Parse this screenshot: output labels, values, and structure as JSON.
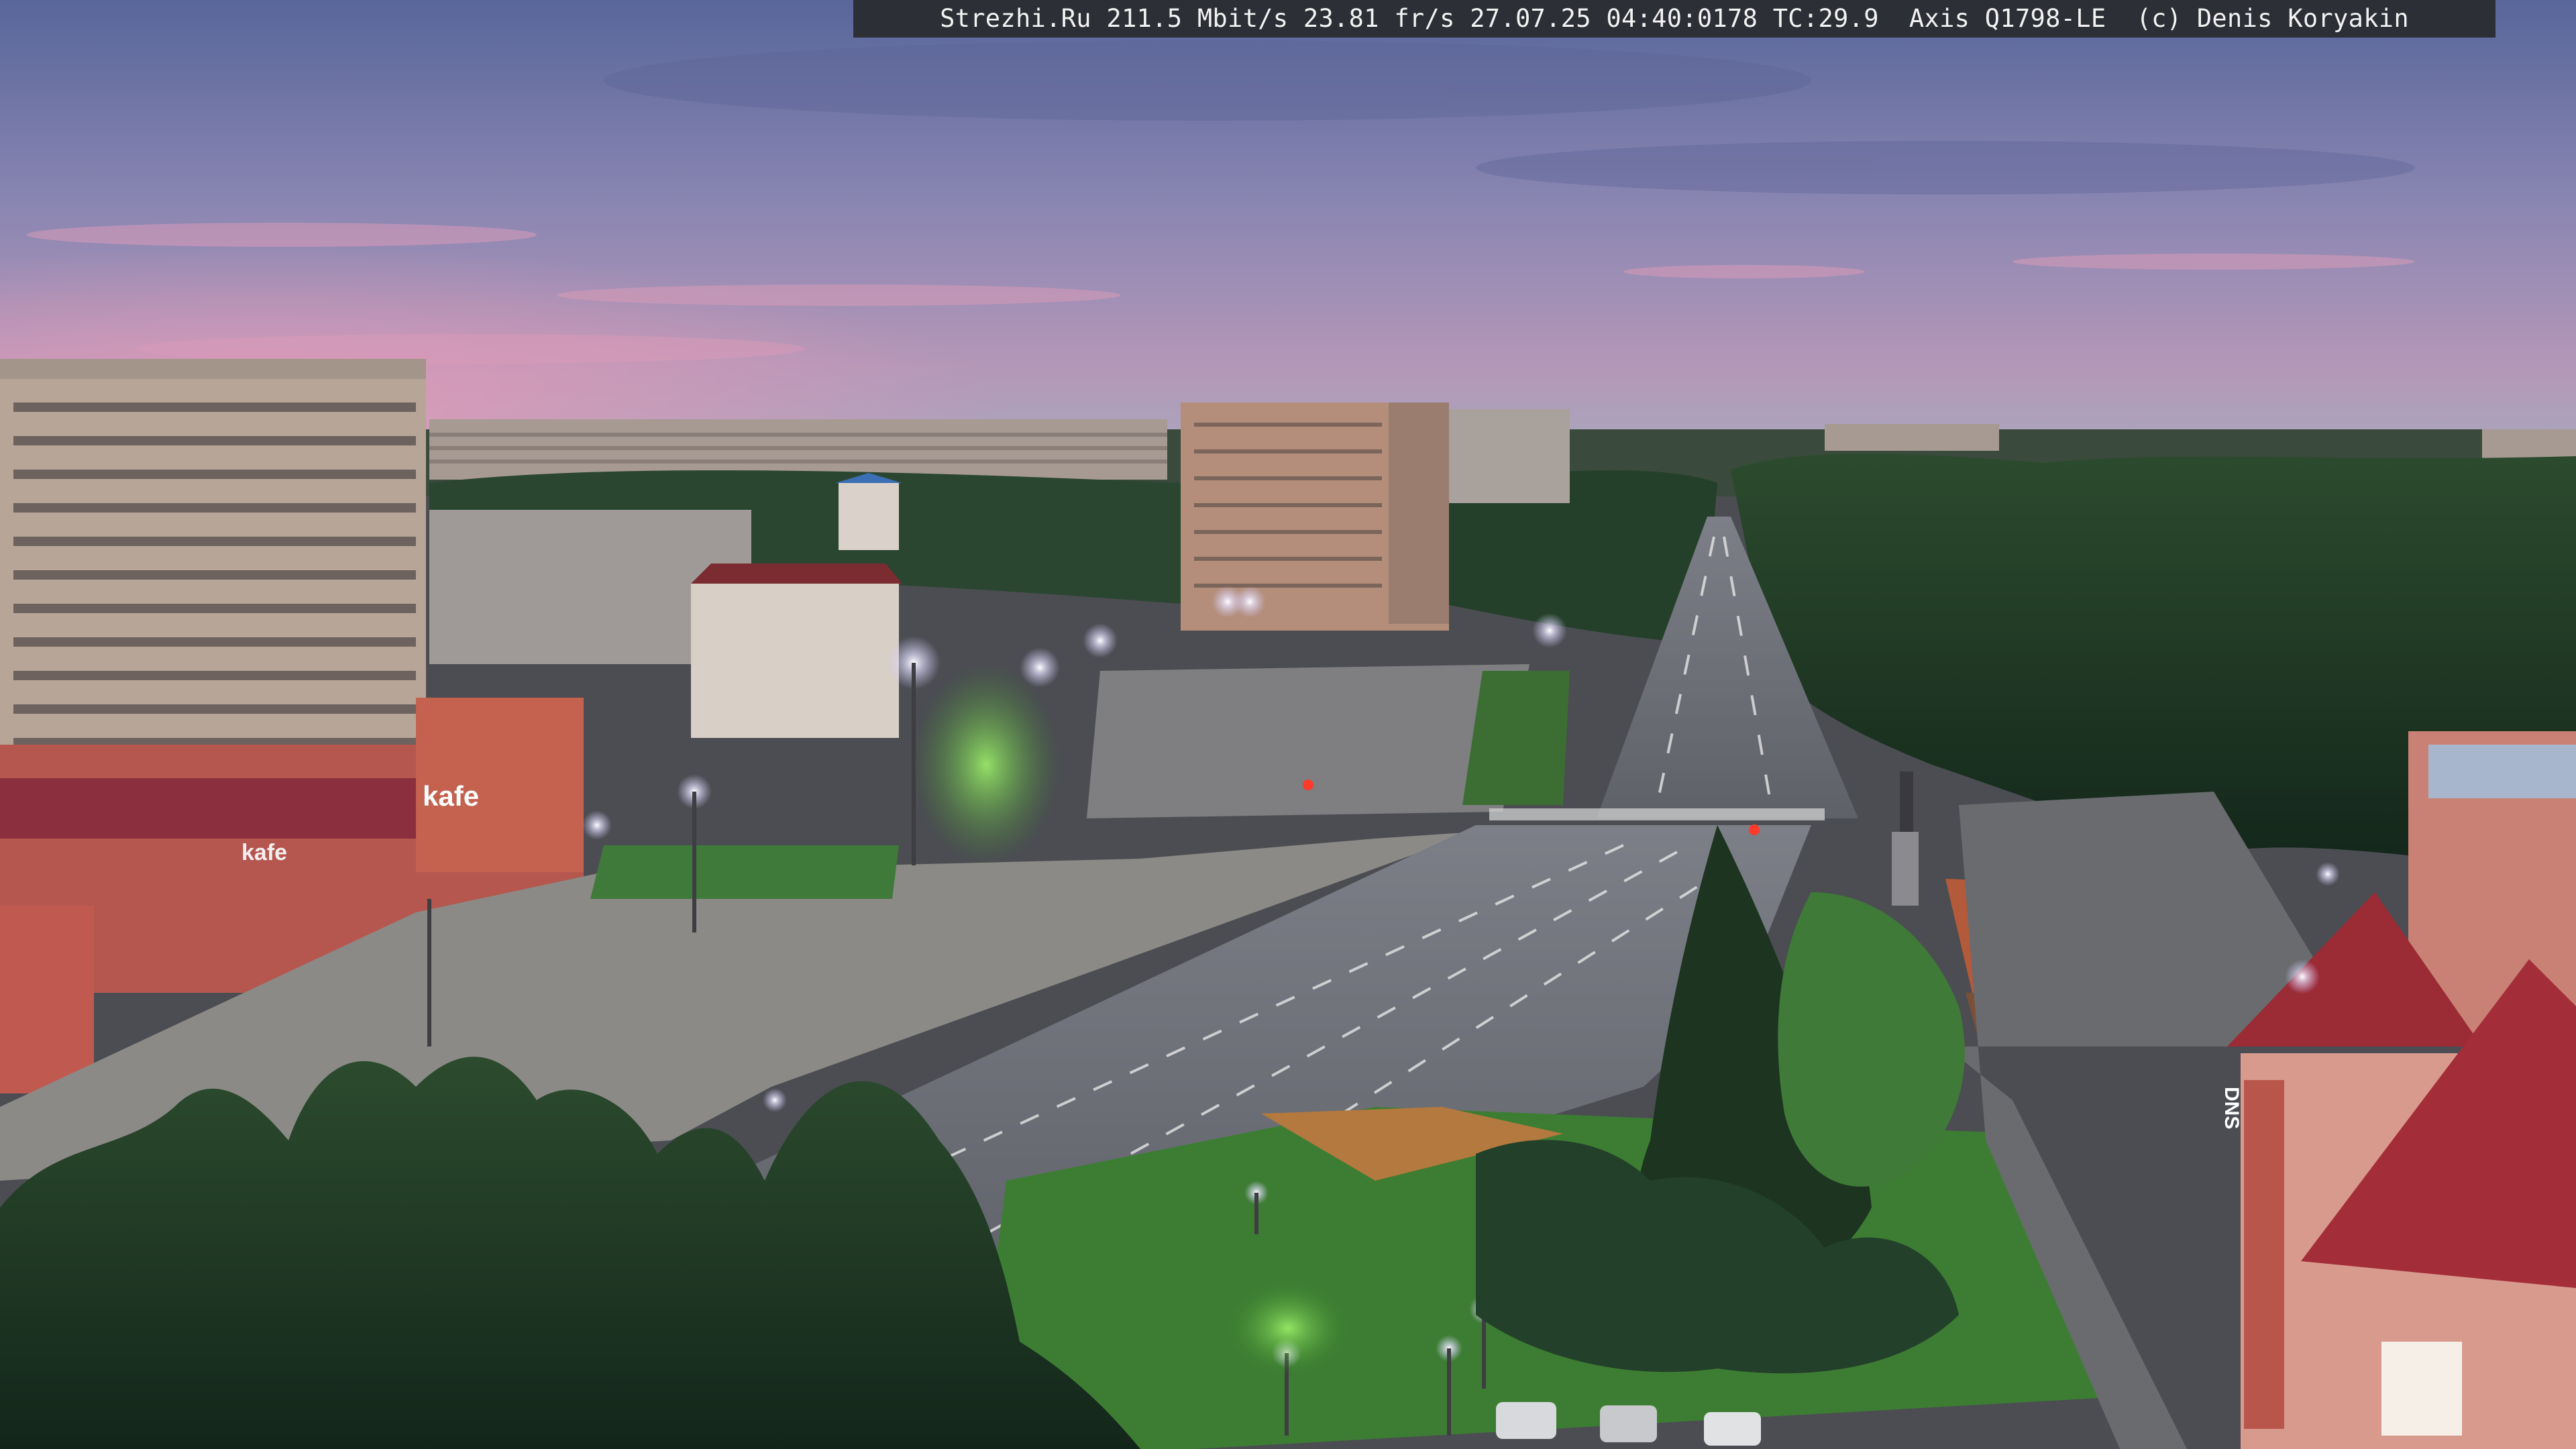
{
  "overlay": {
    "text": "Strezhi.Ru 211.5 Mbit/s 23.81 fr/s 27.07.25 04:40:0178 TC:29.9  Axis Q1798-LE  (c) Denis Koryakin"
  },
  "signs": {
    "kafe_facade": "kafe",
    "kafe_small": "kafe",
    "dns": "DNS"
  },
  "palette": {
    "sky_top": "#5d6a9c",
    "sky_pink": "#c98aa8",
    "trees": "#1f3a22",
    "asphalt": "#6e7078",
    "lamp": "#f4f0ff",
    "brick": "#b8534a",
    "roof_red": "#9b2b35"
  }
}
